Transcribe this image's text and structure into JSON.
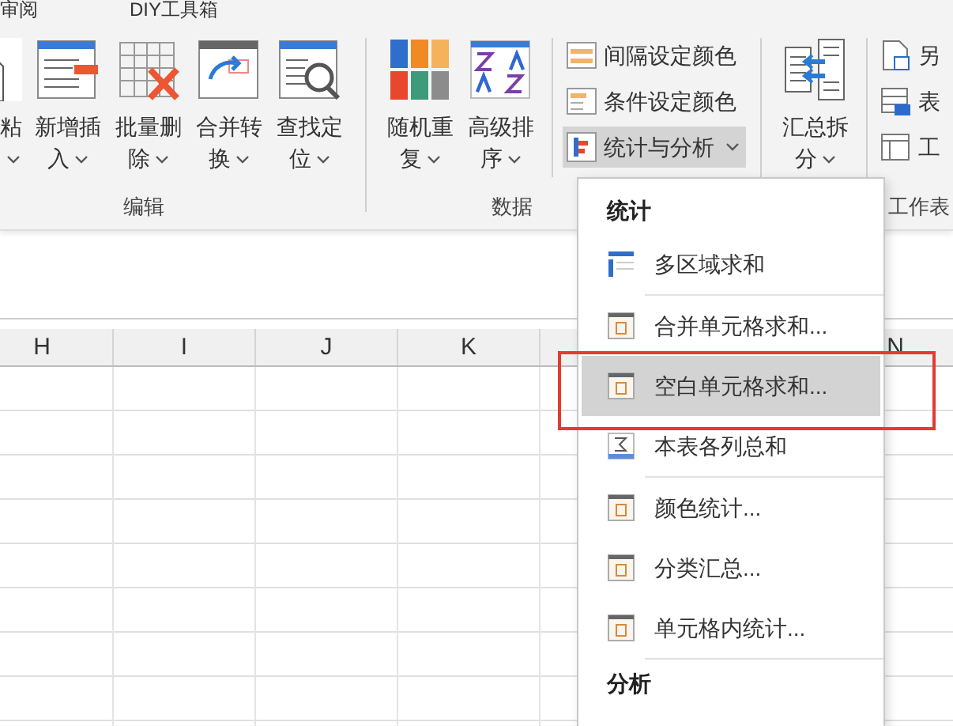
{
  "tabs": [
    "审阅",
    "DIY工具箱"
  ],
  "groups": [
    {
      "label": "编辑",
      "items": [
        {
          "kind": "large-cut",
          "label": "粘",
          "dropdown": true
        },
        {
          "kind": "large",
          "label": "新增插入",
          "dropdown": true
        },
        {
          "kind": "large",
          "label": "批量删除",
          "dropdown": true
        },
        {
          "kind": "large",
          "label": "合并转换",
          "dropdown": true
        },
        {
          "kind": "large",
          "label": "查找定位",
          "dropdown": true
        }
      ]
    },
    {
      "label": "数据",
      "items": [
        {
          "kind": "large",
          "label": "随机重复",
          "dropdown": true
        },
        {
          "kind": "large",
          "label": "高级排序",
          "dropdown": true
        },
        {
          "kind": "small-stack",
          "buttons": [
            {
              "label": "间隔设定颜色",
              "dropdown": false,
              "pressed": false
            },
            {
              "label": "条件设定颜色",
              "dropdown": false,
              "pressed": false
            },
            {
              "label": "统计与分析",
              "dropdown": true,
              "pressed": true
            }
          ]
        }
      ]
    },
    {
      "label": "工作表",
      "items": [
        {
          "kind": "large",
          "label": "汇总拆分",
          "dropdown": true
        },
        {
          "kind": "small-stack",
          "buttons": [
            {
              "label": "另",
              "dropdown": false,
              "pressed": false
            },
            {
              "label": "表",
              "dropdown": false,
              "pressed": false
            },
            {
              "label": "工",
              "dropdown": false,
              "pressed": false
            }
          ]
        }
      ]
    }
  ],
  "sheet": {
    "columns": [
      "H",
      "I",
      "J",
      "K",
      "N"
    ]
  },
  "menu": [
    {
      "kind": "header",
      "label": "统计"
    },
    {
      "kind": "area-item",
      "label": "多区域求和",
      "selected": false
    },
    {
      "kind": "separator"
    },
    {
      "kind": "dialog-item",
      "label": "合并单元格求和...",
      "selected": false
    },
    {
      "kind": "dialog-item",
      "label": "空白单元格求和...",
      "selected": true
    },
    {
      "kind": "sum-item",
      "label": "本表各列总和",
      "selected": false
    },
    {
      "kind": "separator"
    },
    {
      "kind": "dialog-item",
      "label": "颜色统计...",
      "selected": false
    },
    {
      "kind": "dialog-item",
      "label": "分类汇总...",
      "selected": false
    },
    {
      "kind": "dialog-item",
      "label": "单元格内统计...",
      "selected": false
    },
    {
      "kind": "separator"
    },
    {
      "kind": "header",
      "label": "分析"
    }
  ]
}
